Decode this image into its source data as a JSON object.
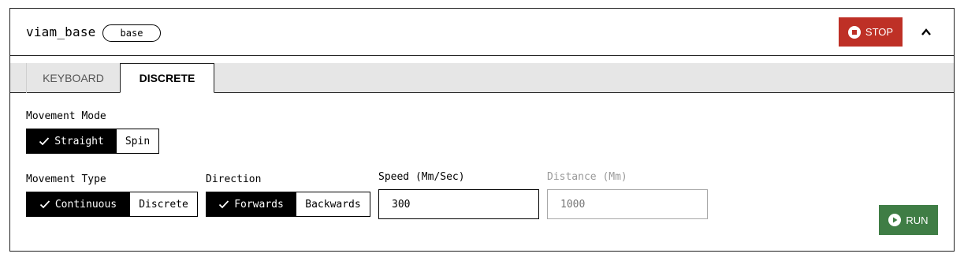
{
  "header": {
    "title": "viam_base",
    "type_badge": "base",
    "stop_label": "STOP",
    "stop_color": "#be3026"
  },
  "tabs": [
    {
      "label": "KEYBOARD",
      "active": false
    },
    {
      "label": "DISCRETE",
      "active": true
    }
  ],
  "movement_mode": {
    "label": "Movement Mode",
    "options": [
      {
        "label": "Straight",
        "selected": true
      },
      {
        "label": "Spin",
        "selected": false
      }
    ]
  },
  "movement_type": {
    "label": "Movement Type",
    "options": [
      {
        "label": "Continuous",
        "selected": true
      },
      {
        "label": "Discrete",
        "selected": false
      }
    ]
  },
  "direction": {
    "label": "Direction",
    "options": [
      {
        "label": "Forwards",
        "selected": true
      },
      {
        "label": "Backwards",
        "selected": false
      }
    ]
  },
  "speed": {
    "label": "Speed (Mm/Sec)",
    "value": "300"
  },
  "distance": {
    "label": "Distance (Mm)",
    "placeholder": "1000",
    "disabled": true
  },
  "run": {
    "label": "RUN",
    "color": "#3f7d45"
  },
  "icons": {
    "stop": "stop-circle-icon",
    "collapse": "chevron-up-icon",
    "check": "check-icon",
    "run": "play-circle-icon"
  }
}
